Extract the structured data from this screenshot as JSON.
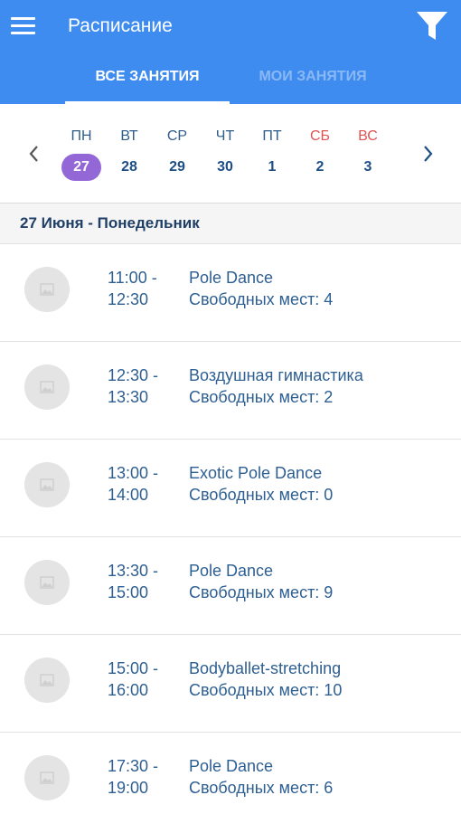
{
  "header": {
    "title": "Расписание",
    "menu_icon": "hamburger-menu-icon",
    "filter_icon": "filter-funnel-icon",
    "color": "#3f8cf0"
  },
  "tabs": [
    {
      "label": "ВСЕ ЗАНЯТИЯ",
      "active": true
    },
    {
      "label": "МОИ ЗАНЯТИЯ",
      "active": false
    }
  ],
  "week": {
    "prev_icon": "chevron-left-icon",
    "next_icon": "chevron-right-icon",
    "days": [
      {
        "dow": "ПН",
        "date": "27",
        "selected": true,
        "weekend": false
      },
      {
        "dow": "ВТ",
        "date": "28",
        "selected": false,
        "weekend": false
      },
      {
        "dow": "СР",
        "date": "29",
        "selected": false,
        "weekend": false
      },
      {
        "dow": "ЧТ",
        "date": "30",
        "selected": false,
        "weekend": false
      },
      {
        "dow": "ПТ",
        "date": "1",
        "selected": false,
        "weekend": false
      },
      {
        "dow": "СБ",
        "date": "2",
        "selected": false,
        "weekend": true
      },
      {
        "dow": "ВС",
        "date": "3",
        "selected": false,
        "weekend": true
      }
    ],
    "selected_color": "#9467d6",
    "weekend_color": "#e05353"
  },
  "date_header": "27 Июня - Понедельник",
  "sessions": [
    {
      "start": "11:00 -",
      "end": "12:30",
      "name": "Pole Dance",
      "seats": "Свободных мест: 4"
    },
    {
      "start": "12:30 -",
      "end": "13:30",
      "name": "Воздушная гимнастика",
      "seats": "Свободных мест: 2"
    },
    {
      "start": "13:00 -",
      "end": "14:00",
      "name": "Exotic Pole Dance",
      "seats": "Свободных мест: 0"
    },
    {
      "start": "13:30 -",
      "end": "15:00",
      "name": "Pole Dance",
      "seats": "Свободных мест: 9"
    },
    {
      "start": "15:00 -",
      "end": "16:00",
      "name": "Bodyballet-stretching",
      "seats": "Свободных мест: 10"
    },
    {
      "start": "17:30 -",
      "end": "19:00",
      "name": "Pole Dance",
      "seats": "Свободных мест: 6"
    }
  ],
  "session_icon": "image-placeholder-icon"
}
